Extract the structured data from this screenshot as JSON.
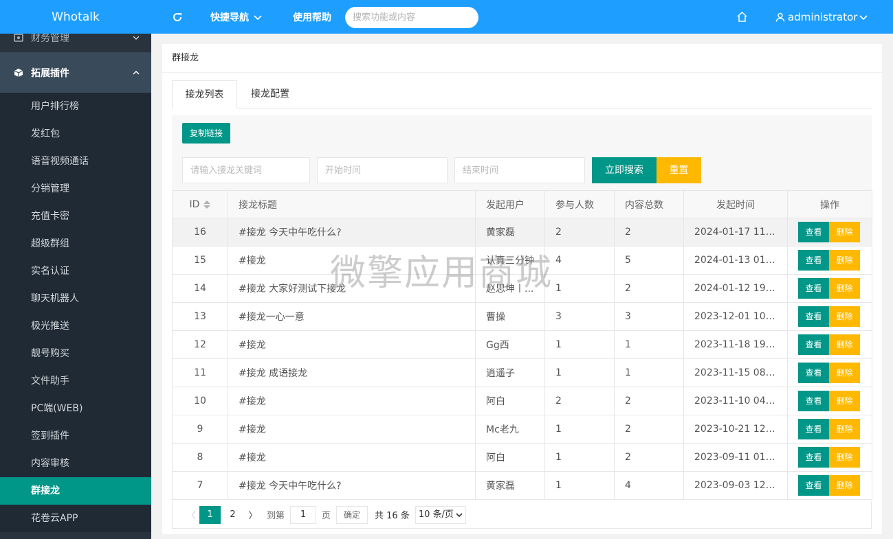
{
  "app": {
    "title": "Whotalk"
  },
  "sidebar": {
    "partial_group": {
      "label": "财务管理",
      "icon": "wallet-icon"
    },
    "open_group": {
      "label": "拓展插件",
      "icon": "cube-icon"
    },
    "items": [
      {
        "label": "用户排行榜"
      },
      {
        "label": "发红包"
      },
      {
        "label": "语音视频通话"
      },
      {
        "label": "分销管理"
      },
      {
        "label": "充值卡密"
      },
      {
        "label": "超级群组"
      },
      {
        "label": "实名认证"
      },
      {
        "label": "聊天机器人"
      },
      {
        "label": "极光推送"
      },
      {
        "label": "靓号购买"
      },
      {
        "label": "文件助手"
      },
      {
        "label": "PC端(WEB)"
      },
      {
        "label": "签到插件"
      },
      {
        "label": "内容审核"
      },
      {
        "label": "群接龙",
        "active": true
      },
      {
        "label": "花卷云APP"
      }
    ]
  },
  "topbar": {
    "refresh_icon": "refresh-icon",
    "quick_nav": "快捷导航",
    "help": "使用帮助",
    "search_placeholder": "搜索功能或内容",
    "home_icon": "home-icon",
    "user": "administrator"
  },
  "page": {
    "title": "群接龙",
    "tabs": [
      {
        "label": "接龙列表",
        "active": true
      },
      {
        "label": "接龙配置"
      }
    ],
    "copy_link": "复制链接",
    "filters": {
      "keyword_placeholder": "请输入接龙关键词",
      "start_placeholder": "开始时间",
      "end_placeholder": "结束时间",
      "search_button": "立即搜索",
      "reset_button": "重置"
    },
    "table": {
      "columns": [
        "ID",
        "接龙标题",
        "发起用户",
        "参与人数",
        "内容总数",
        "发起时间",
        "操作"
      ],
      "rows": [
        {
          "id": "16",
          "title": "#接龙 今天中午吃什么?",
          "user": "黄家磊",
          "participants": "2",
          "contents": "2",
          "time": "2024-01-17 11:..."
        },
        {
          "id": "15",
          "title": "#接龙",
          "user": "认真三分钟",
          "participants": "4",
          "contents": "5",
          "time": "2024-01-13 01:..."
        },
        {
          "id": "14",
          "title": "#接龙 大家好测试下接龙",
          "user": "赵思坤丨...",
          "participants": "1",
          "contents": "2",
          "time": "2024-01-12 19:..."
        },
        {
          "id": "13",
          "title": "#接龙一心一意",
          "user": "曹操",
          "participants": "3",
          "contents": "3",
          "time": "2023-12-01 10:..."
        },
        {
          "id": "12",
          "title": "#接龙",
          "user": "Gg西",
          "participants": "1",
          "contents": "1",
          "time": "2023-11-18 19:..."
        },
        {
          "id": "11",
          "title": "#接龙 成语接龙",
          "user": "逍遥子",
          "participants": "1",
          "contents": "1",
          "time": "2023-11-15 08:..."
        },
        {
          "id": "10",
          "title": "#接龙",
          "user": "阿白",
          "participants": "2",
          "contents": "2",
          "time": "2023-11-10 04:..."
        },
        {
          "id": "9",
          "title": "#接龙",
          "user": "Mc老九",
          "participants": "1",
          "contents": "2",
          "time": "2023-10-21 12:..."
        },
        {
          "id": "8",
          "title": "#接龙",
          "user": "阿白",
          "participants": "1",
          "contents": "2",
          "time": "2023-09-11 01:..."
        },
        {
          "id": "7",
          "title": "#接龙 今天中午吃什么?",
          "user": "黄家磊",
          "participants": "1",
          "contents": "4",
          "time": "2023-09-03 12:..."
        }
      ],
      "view_label": "查看",
      "delete_label": "删除"
    },
    "pagination": {
      "pages": [
        "1",
        "2"
      ],
      "current": "1",
      "goto_label": "到第",
      "goto_value": "1",
      "page_unit": "页",
      "confirm": "确定",
      "total": "共 16 条",
      "page_size": "10 条/页"
    }
  },
  "watermark": "微擎应用商城",
  "colors": {
    "primary": "#1e9fff",
    "teal": "#009688",
    "warn": "#ffb800",
    "sidebar": "#28333e"
  }
}
